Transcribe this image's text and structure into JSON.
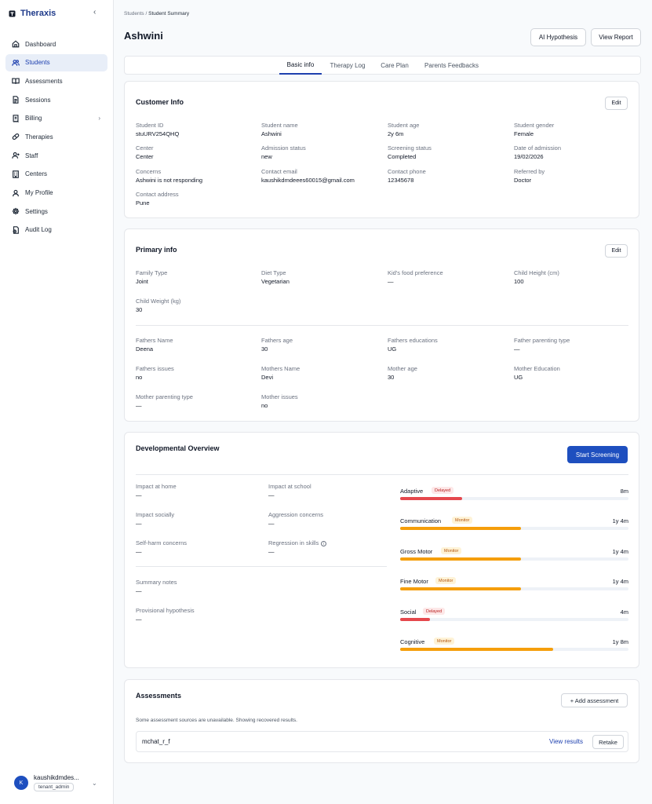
{
  "app": {
    "name": "Theraxis"
  },
  "sidebar": {
    "items": [
      {
        "label": "Dashboard"
      },
      {
        "label": "Students"
      },
      {
        "label": "Assessments"
      },
      {
        "label": "Sessions"
      },
      {
        "label": "Billing"
      },
      {
        "label": "Therapies"
      },
      {
        "label": "Staff"
      },
      {
        "label": "Centers"
      },
      {
        "label": "My Profile"
      },
      {
        "label": "Settings"
      },
      {
        "label": "Audit Log"
      }
    ],
    "active": "Students"
  },
  "user": {
    "initial": "K",
    "name": "kaushikdmdes...",
    "role": "tenant_admin"
  },
  "breadcrumb": {
    "parent": "Students",
    "sep": "/",
    "current": "Student Summary"
  },
  "page": {
    "title": "Ashwini",
    "ai_button": "AI Hypothesis",
    "report_button": "View Report"
  },
  "tabs": [
    "Basic info",
    "Therapy Log",
    "Care Plan",
    "Parents Feedbacks"
  ],
  "customer_info": {
    "title": "Customer Info",
    "edit": "Edit",
    "fields": [
      {
        "label": "Student ID",
        "value": "stuURV254QHQ"
      },
      {
        "label": "Student name",
        "value": "Ashwini"
      },
      {
        "label": "Student age",
        "value": "2y 6m"
      },
      {
        "label": "Student gender",
        "value": "Female"
      },
      {
        "label": "Center",
        "value": "Center"
      },
      {
        "label": "Admission status",
        "value": "new"
      },
      {
        "label": "Screening status",
        "value": "Completed"
      },
      {
        "label": "Date of admission",
        "value": "19/02/2026"
      },
      {
        "label": "Concerns",
        "value": "Ashwini is not responding"
      },
      {
        "label": "Contact email",
        "value": "kaushikdmdeees60015@gmail.com"
      },
      {
        "label": "Contact phone",
        "value": "12345678"
      },
      {
        "label": "Referred by",
        "value": "Doctor"
      },
      {
        "label": "Contact address",
        "value": "Pune"
      }
    ]
  },
  "primary_info": {
    "title": "Primary info",
    "edit": "Edit",
    "fields": [
      {
        "label": "Family Type",
        "value": "Joint"
      },
      {
        "label": "Diet Type",
        "value": "Vegetarian"
      },
      {
        "label": "Kid's food preference",
        "value": "—"
      },
      {
        "label": "Child Height (cm)",
        "value": "100"
      },
      {
        "label": "Child Weight (kg)",
        "value": "30"
      },
      {
        "label": "Fathers Name",
        "value": "Deena"
      },
      {
        "label": "Fathers age",
        "value": "30"
      },
      {
        "label": "Fathers educations",
        "value": "UG"
      },
      {
        "label": "Father parenting type",
        "value": "—"
      },
      {
        "label": "Fathers issues",
        "value": "no"
      },
      {
        "label": "Mothers Name",
        "value": "Devi"
      },
      {
        "label": "Mother age",
        "value": "30"
      },
      {
        "label": "Mother Education",
        "value": "UG"
      },
      {
        "label": "Mother parenting type",
        "value": "—"
      },
      {
        "label": "Mother issues",
        "value": "no"
      }
    ]
  },
  "developmental": {
    "title": "Developmental Overview",
    "start_button": "Start Screening",
    "fields": [
      {
        "label": "Impact at home",
        "value": "—"
      },
      {
        "label": "Impact at school",
        "value": "—"
      },
      {
        "label": "Impact socially",
        "value": "—"
      },
      {
        "label": "Aggression concerns",
        "value": "—"
      },
      {
        "label": "Self-harm concerns",
        "value": "—"
      },
      {
        "label": "Regression in skills",
        "value": "—"
      },
      {
        "label": "Summary notes",
        "value": "—"
      },
      {
        "label": "Provisional hypothesis",
        "value": "—"
      }
    ],
    "domains": [
      {
        "name": "Adaptive",
        "status": "Delayed",
        "value": "8m",
        "progress": 0.27
      },
      {
        "name": "Communication",
        "status": "Monitor",
        "value": "1y 4m",
        "progress": 0.53
      },
      {
        "name": "Gross Motor",
        "status": "Monitor",
        "value": "1y 4m",
        "progress": 0.53
      },
      {
        "name": "Fine Motor",
        "status": "Monitor",
        "value": "1y 4m",
        "progress": 0.53
      },
      {
        "name": "Social",
        "status": "Delayed",
        "value": "4m",
        "progress": 0.13
      },
      {
        "name": "Cognitive",
        "status": "Monitor",
        "value": "1y 8m",
        "progress": 0.67
      }
    ],
    "colors": {
      "Delayed": "#e5484d",
      "Monitor": "#f59e0b"
    }
  },
  "assessments": {
    "title": "Assessments",
    "add_button": "+ Add assessment",
    "note": "Some assessment sources are unavailable. Showing recovered results.",
    "rows": [
      {
        "name": "mchat_r_f",
        "view": "View results",
        "retake": "Retake"
      }
    ]
  }
}
